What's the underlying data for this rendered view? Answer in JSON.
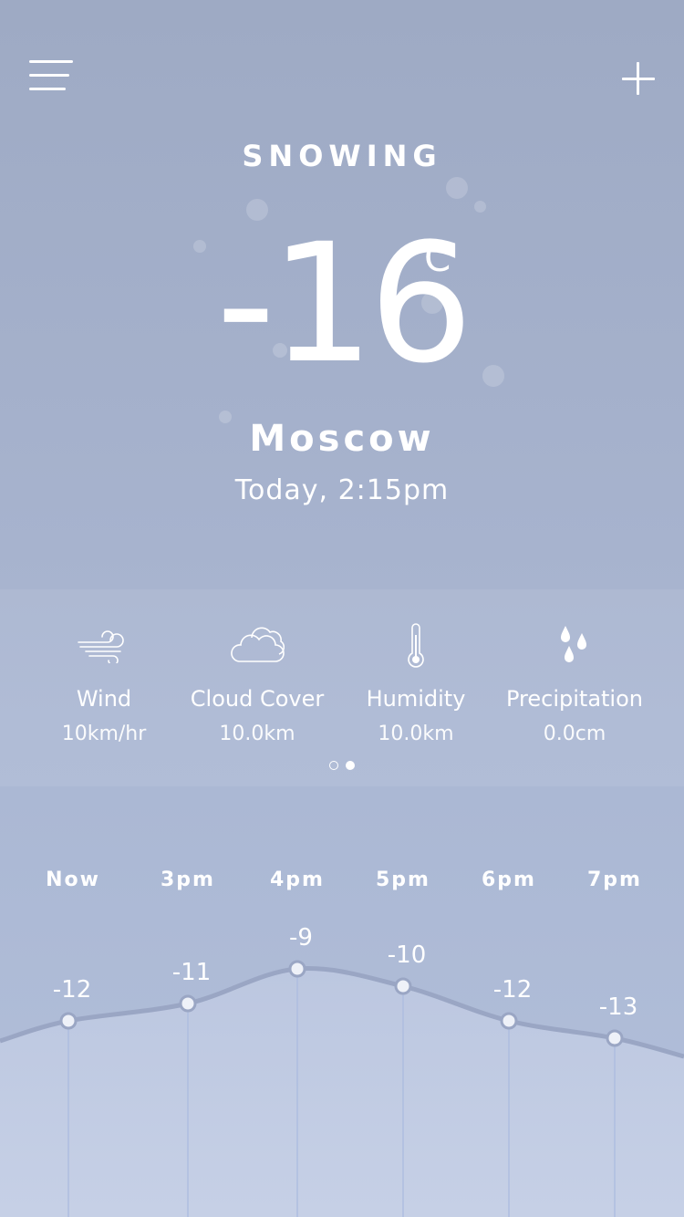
{
  "header": {
    "menu_icon": "menu-icon",
    "add_icon": "plus-icon"
  },
  "weather": {
    "condition": "SNOWING",
    "temperature": "-16",
    "unit": "°C",
    "city": "Moscow",
    "datetime": "Today, 2:15pm"
  },
  "stats": [
    {
      "icon": "wind-icon",
      "label": "Wind",
      "value": "10km/hr"
    },
    {
      "icon": "cloud-icon",
      "label": "Cloud Cover",
      "value": "10.0km"
    },
    {
      "icon": "thermometer-icon",
      "label": "Humidity",
      "value": "10.0km"
    },
    {
      "icon": "raindrops-icon",
      "label": "Precipitation",
      "value": "0.0cm"
    }
  ],
  "pager": {
    "pages": 2,
    "current": 2
  },
  "colors": {
    "line": "#9aa6c4",
    "area_top": "#bcc7e0",
    "area_bottom": "#c6d0e6",
    "dot": "#eef1f8"
  },
  "chart_data": {
    "type": "line",
    "categories": [
      "Now",
      "3pm",
      "4pm",
      "5pm",
      "6pm",
      "7pm"
    ],
    "values": [
      -12,
      -11,
      -9,
      -10,
      -12,
      -13
    ],
    "data_labels": [
      "-12",
      "-11",
      "-9",
      "-10",
      "-12",
      "-13"
    ]
  }
}
